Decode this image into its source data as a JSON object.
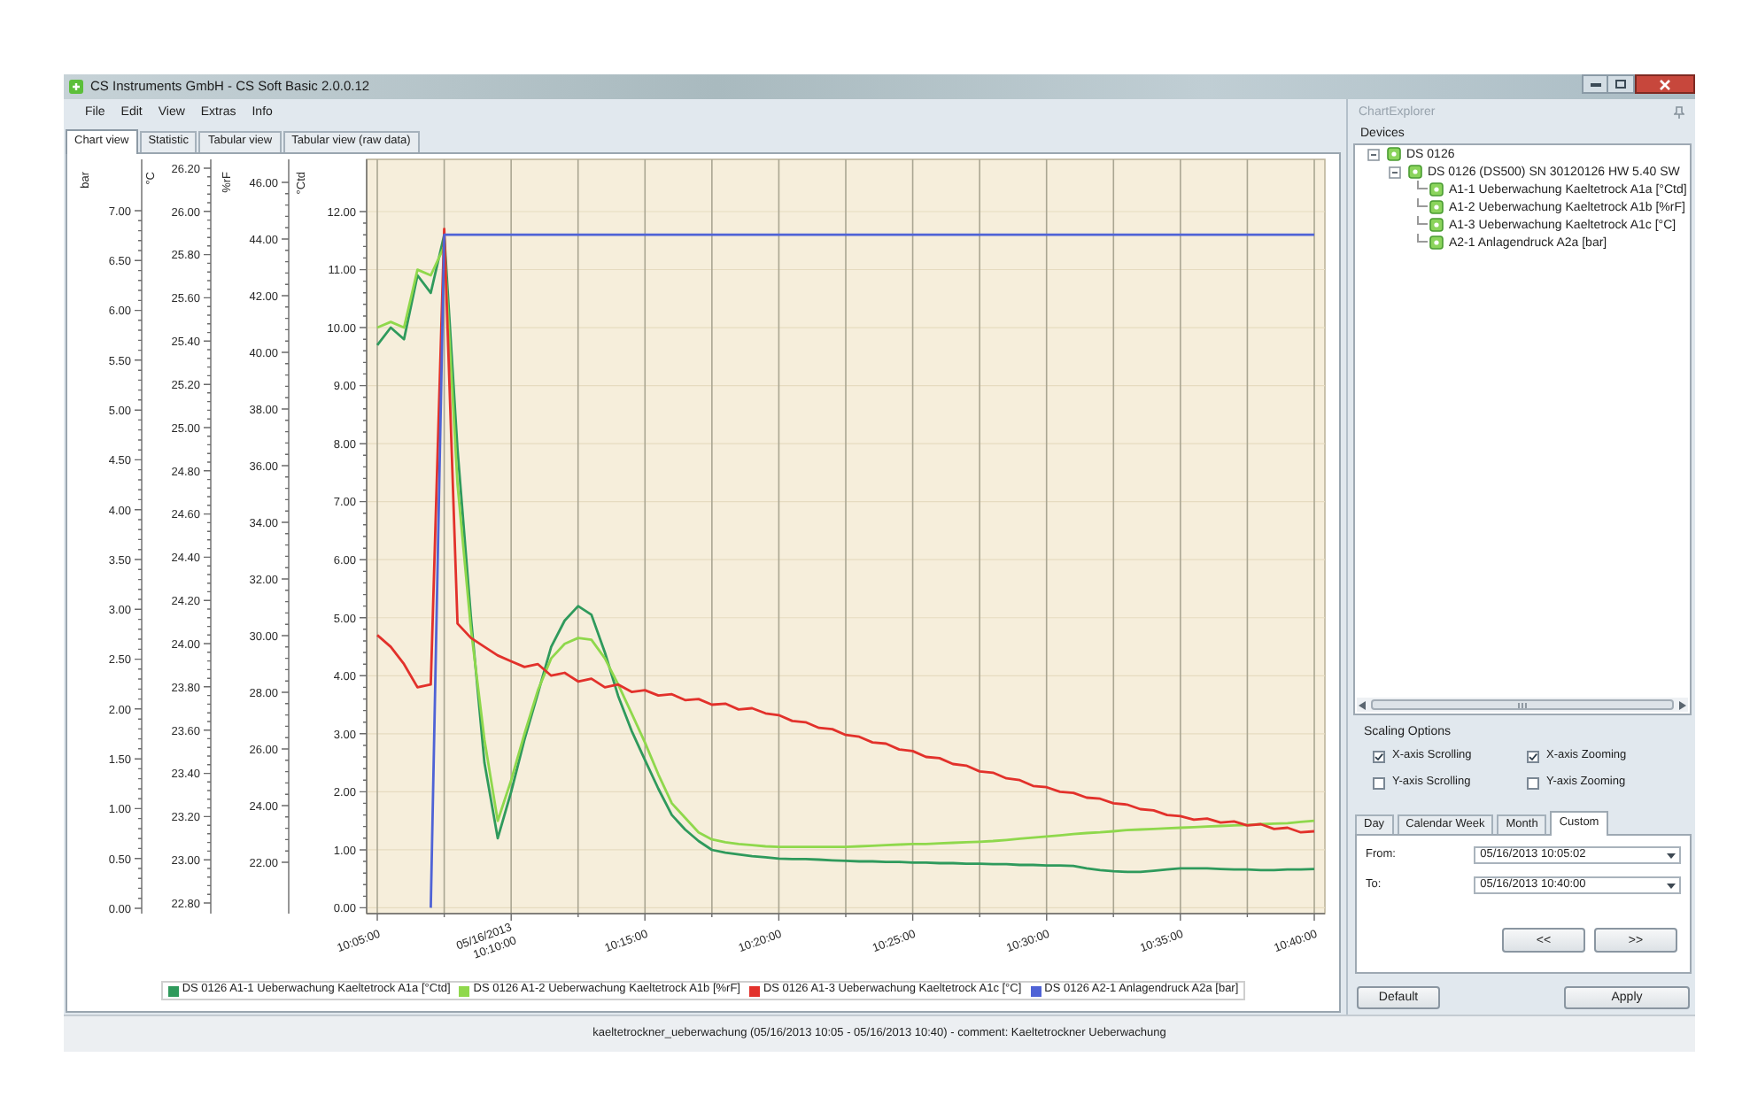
{
  "window": {
    "title": "CS Instruments GmbH - CS Soft Basic 2.0.0.12"
  },
  "menu": [
    "File",
    "Edit",
    "View",
    "Extras",
    "Info"
  ],
  "tabs": [
    {
      "label": "Chart view",
      "selected": true
    },
    {
      "label": "Statistic",
      "selected": false
    },
    {
      "label": "Tabular view",
      "selected": false
    },
    {
      "label": "Tabular view (raw data)",
      "selected": false
    }
  ],
  "chart": {
    "extra_axes": [
      {
        "title": "bar",
        "ticks": [
          "7.00",
          "6.50",
          "6.00",
          "5.50",
          "5.00",
          "4.50",
          "4.00",
          "3.50",
          "3.00",
          "2.50",
          "2.00",
          "1.50",
          "1.00",
          "0.50",
          "0.00"
        ]
      },
      {
        "title": "°C",
        "ticks": [
          "26.20",
          "26.00",
          "25.80",
          "25.60",
          "25.40",
          "25.20",
          "25.00",
          "24.80",
          "24.60",
          "24.40",
          "24.20",
          "24.00",
          "23.80",
          "23.60",
          "23.40",
          "23.20",
          "23.00",
          "22.80"
        ]
      },
      {
        "title": "%rF",
        "ticks": [
          "46.00",
          "44.00",
          "42.00",
          "40.00",
          "38.00",
          "36.00",
          "34.00",
          "32.00",
          "30.00",
          "28.00",
          "26.00",
          "24.00",
          "22.00"
        ]
      }
    ],
    "chart_data": {
      "type": "line",
      "ylabel": "°Ctd",
      "grid": true,
      "legend": "bottom",
      "categories": [
        "10:05:00",
        null,
        null,
        null,
        null,
        null,
        null,
        null,
        null,
        null,
        "05/16/2013 10:10:00",
        null,
        null,
        null,
        null,
        null,
        null,
        null,
        null,
        null,
        "10:15:00",
        null,
        null,
        null,
        null,
        null,
        null,
        null,
        null,
        null,
        "10:20:00",
        null,
        null,
        null,
        null,
        null,
        null,
        null,
        null,
        null,
        "10:25:00",
        null,
        null,
        null,
        null,
        null,
        null,
        null,
        null,
        null,
        "10:30:00",
        null,
        null,
        null,
        null,
        null,
        null,
        null,
        null,
        null,
        "10:35:00",
        null,
        null,
        null,
        null,
        null,
        null,
        null,
        null,
        null,
        "10:40:00"
      ],
      "ylim": [
        -0.1,
        12.9
      ],
      "yticks": [
        {
          "value": 12,
          "label": "12.00"
        },
        {
          "value": 11,
          "label": "11.00"
        },
        {
          "value": 10,
          "label": "10.00"
        },
        {
          "value": 9,
          "label": "9.00"
        },
        {
          "value": 8,
          "label": "8.00"
        },
        {
          "value": 7,
          "label": "7.00"
        },
        {
          "value": 6,
          "label": "6.00"
        },
        {
          "value": 5,
          "label": "5.00"
        },
        {
          "value": 4,
          "label": "4.00"
        },
        {
          "value": 3,
          "label": "3.00"
        },
        {
          "value": 2,
          "label": "2.00"
        },
        {
          "value": 1,
          "label": "1.00"
        },
        {
          "value": 0,
          "label": "0.00"
        }
      ],
      "series": [
        {
          "name": "DS 0126 A1-1 Ueberwachung Kaeltetrock A1a [°Ctd]",
          "color": "#2f9a5c",
          "values": [
            9.7,
            10.0,
            9.8,
            10.9,
            10.6,
            11.6,
            7.9,
            5.0,
            2.5,
            1.2,
            2.0,
            2.9,
            3.7,
            4.5,
            4.95,
            5.2,
            5.05,
            4.4,
            3.65,
            3.05,
            2.55,
            2.05,
            1.6,
            1.35,
            1.15,
            1.0,
            0.95,
            0.92,
            0.89,
            0.87,
            0.85,
            0.84,
            0.84,
            0.83,
            0.82,
            0.81,
            0.8,
            0.8,
            0.79,
            0.79,
            0.78,
            0.78,
            0.77,
            0.77,
            0.76,
            0.76,
            0.75,
            0.75,
            0.74,
            0.74,
            0.73,
            0.73,
            0.72,
            0.68,
            0.65,
            0.63,
            0.62,
            0.62,
            0.64,
            0.66,
            0.68,
            0.68,
            0.68,
            0.67,
            0.66,
            0.66,
            0.65,
            0.65,
            0.66,
            0.66,
            0.67
          ]
        },
        {
          "name": "DS 0126 A1-2 Ueberwachung Kaeltetrock A1b [%rF]",
          "color": "#8fd84c",
          "values": [
            10.0,
            10.1,
            10.0,
            11.0,
            10.9,
            11.4,
            7.3,
            4.8,
            2.9,
            1.5,
            2.2,
            3.0,
            3.75,
            4.3,
            4.55,
            4.65,
            4.62,
            4.3,
            3.85,
            3.35,
            2.85,
            2.3,
            1.8,
            1.55,
            1.3,
            1.18,
            1.13,
            1.1,
            1.08,
            1.06,
            1.05,
            1.05,
            1.05,
            1.05,
            1.05,
            1.05,
            1.06,
            1.07,
            1.08,
            1.09,
            1.1,
            1.1,
            1.11,
            1.12,
            1.13,
            1.14,
            1.15,
            1.17,
            1.19,
            1.21,
            1.23,
            1.25,
            1.27,
            1.29,
            1.3,
            1.32,
            1.34,
            1.35,
            1.36,
            1.37,
            1.38,
            1.39,
            1.4,
            1.41,
            1.42,
            1.43,
            1.44,
            1.45,
            1.46,
            1.48,
            1.5
          ]
        },
        {
          "name": "DS 0126 A1-3 Ueberwachung Kaeltetrock A1c [°C]",
          "color": "#e2312b",
          "values": [
            4.7,
            4.5,
            4.2,
            3.8,
            3.85,
            11.7,
            4.9,
            4.65,
            4.5,
            4.35,
            4.25,
            4.15,
            4.2,
            4.0,
            4.05,
            3.9,
            3.95,
            3.8,
            3.85,
            3.72,
            3.75,
            3.66,
            3.68,
            3.58,
            3.6,
            3.5,
            3.52,
            3.42,
            3.44,
            3.35,
            3.32,
            3.22,
            3.2,
            3.1,
            3.08,
            2.98,
            2.95,
            2.85,
            2.83,
            2.73,
            2.7,
            2.6,
            2.58,
            2.48,
            2.45,
            2.35,
            2.33,
            2.23,
            2.2,
            2.1,
            2.08,
            2.0,
            1.98,
            1.9,
            1.88,
            1.8,
            1.78,
            1.7,
            1.68,
            1.6,
            1.58,
            1.52,
            1.54,
            1.47,
            1.49,
            1.42,
            1.44,
            1.36,
            1.38,
            1.3,
            1.32
          ]
        },
        {
          "name": "DS 0126 A2-1 Anlagendruck A2a [bar]",
          "color": "#4f63d6",
          "values": [
            null,
            null,
            null,
            null,
            0,
            11.6,
            11.6,
            11.6,
            11.6,
            11.6,
            11.6,
            11.6,
            11.6,
            11.6,
            11.6,
            11.6,
            11.6,
            11.6,
            11.6,
            11.6,
            11.6,
            11.6,
            11.6,
            11.6,
            11.6,
            11.6,
            11.6,
            11.6,
            11.6,
            11.6,
            11.6,
            11.6,
            11.6,
            11.6,
            11.6,
            11.6,
            11.6,
            11.6,
            11.6,
            11.6,
            11.6,
            11.6,
            11.6,
            11.6,
            11.6,
            11.6,
            11.6,
            11.6,
            11.6,
            11.6,
            11.6,
            11.6,
            11.6,
            11.6,
            11.6,
            11.6,
            11.6,
            11.6,
            11.6,
            11.6,
            11.6,
            11.6,
            11.6,
            11.6,
            11.6,
            11.6,
            11.6,
            11.6,
            11.6,
            11.6,
            11.6
          ]
        }
      ]
    }
  },
  "explorer": {
    "title": "ChartExplorer",
    "devices": {
      "label": "Devices",
      "tree": [
        {
          "label": "DS 0126",
          "expanded": true,
          "children": [
            {
              "label": "DS 0126 (DS500) SN 30120126 HW 5.40 SW",
              "expanded": true,
              "children": [
                {
                  "label": "A1-1 Ueberwachung Kaeltetrock A1a [°Ctd]"
                },
                {
                  "label": "A1-2 Ueberwachung Kaeltetrock A1b [%rF]"
                },
                {
                  "label": "A1-3 Ueberwachung Kaeltetrock A1c [°C]"
                },
                {
                  "label": "A2-1 Anlagendruck A2a [bar]"
                }
              ]
            }
          ]
        }
      ]
    },
    "scaling_options": {
      "label": "Scaling Options",
      "options": [
        {
          "label": "X-axis Scrolling",
          "checked": true
        },
        {
          "label": "X-axis Zooming",
          "checked": true
        },
        {
          "label": "Y-axis Scrolling",
          "checked": false
        },
        {
          "label": "Y-axis Zooming",
          "checked": false
        }
      ]
    },
    "range_tabs": [
      {
        "label": "Day",
        "selected": false
      },
      {
        "label": "Calendar Week",
        "selected": false
      },
      {
        "label": "Month",
        "selected": false
      },
      {
        "label": "Custom",
        "selected": true
      }
    ],
    "range": [
      {
        "label": "From:",
        "value": "05/16/2013 10:05:02"
      },
      {
        "label": "To:",
        "value": "05/16/2013 10:40:00"
      }
    ],
    "nav_buttons": [
      "<<",
      ">>"
    ],
    "footer_buttons": [
      "Default",
      "Apply"
    ]
  },
  "status_bar": {
    "text": "kaeltetrockner_ueberwachung (05/16/2013 10:05 - 05/16/2013 10:40) - comment: Kaeltetrockner Ueberwachung"
  }
}
